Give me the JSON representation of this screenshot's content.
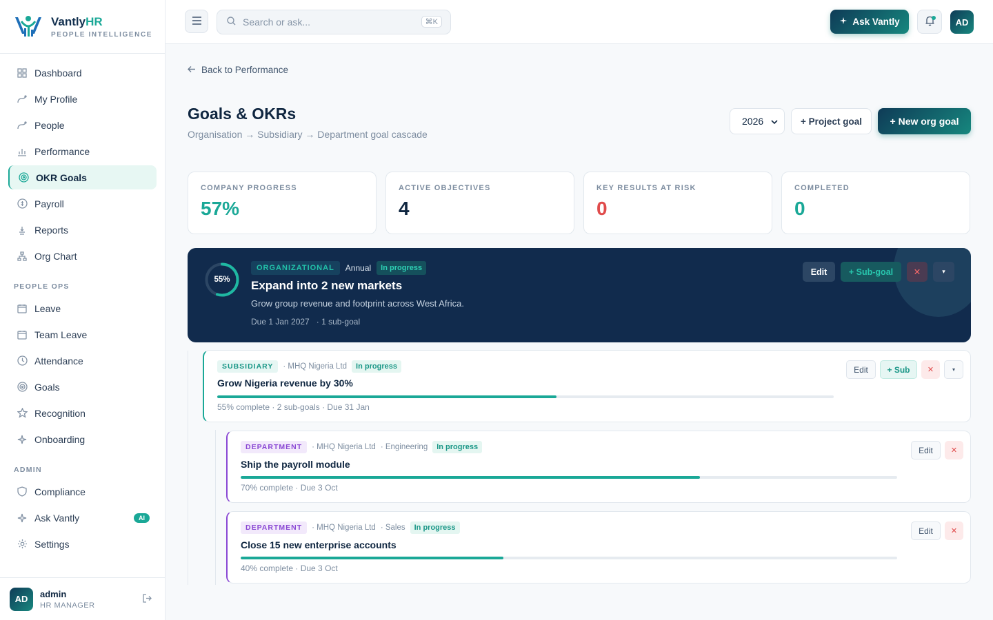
{
  "brand": {
    "name_main": "Vantly",
    "name_accent": "HR",
    "tagline": "PEOPLE INTELLIGENCE"
  },
  "sidebar": {
    "items": [
      {
        "label": "Dashboard",
        "icon": "grid-icon"
      },
      {
        "label": "My Profile",
        "icon": "profile-icon"
      },
      {
        "label": "People",
        "icon": "people-icon"
      },
      {
        "label": "Performance",
        "icon": "bar-chart-icon"
      },
      {
        "label": "OKR Goals",
        "icon": "target-icon",
        "active": true
      },
      {
        "label": "Payroll",
        "icon": "payroll-icon"
      }
    ],
    "items2": [
      {
        "label": "Reports",
        "icon": "reports-icon"
      },
      {
        "label": "Org Chart",
        "icon": "org-chart-icon"
      }
    ],
    "section_people_ops": "PEOPLE OPS",
    "people_ops": [
      {
        "label": "Leave",
        "icon": "calendar-icon"
      },
      {
        "label": "Team Leave",
        "icon": "calendar-icon"
      },
      {
        "label": "Attendance",
        "icon": "clock-icon"
      },
      {
        "label": "Goals",
        "icon": "target-icon"
      },
      {
        "label": "Recognition",
        "icon": "star-icon"
      },
      {
        "label": "Onboarding",
        "icon": "sparkle-icon"
      }
    ],
    "section_admin": "ADMIN",
    "admin": [
      {
        "label": "Compliance",
        "icon": "shield-icon"
      },
      {
        "label": "Ask Vantly",
        "icon": "sparkle-icon",
        "badge": "AI"
      },
      {
        "label": "Settings",
        "icon": "gear-icon"
      }
    ],
    "user": {
      "initials": "AD",
      "name": "admin",
      "role": "HR MANAGER"
    }
  },
  "topbar": {
    "search_placeholder": "Search or ask...",
    "shortcut": "⌘K",
    "ask_label": "Ask Vantly",
    "avatar": "AD"
  },
  "page": {
    "back_label": "Back to Performance",
    "title": "Goals & OKRs",
    "subtitle": "Organisation → Subsidiary → Department goal cascade",
    "year": "2026",
    "project_goal_label": "+ Project goal",
    "new_org_goal_label": "+ New org goal"
  },
  "stats": [
    {
      "label": "COMPANY PROGRESS",
      "value": "57%",
      "color": "#1aa897"
    },
    {
      "label": "ACTIVE OBJECTIVES",
      "value": "4",
      "color": "#0f2640"
    },
    {
      "label": "KEY RESULTS AT RISK",
      "value": "0",
      "color": "#e04b4b"
    },
    {
      "label": "COMPLETED",
      "value": "0",
      "color": "#1aa897"
    }
  ],
  "org_goal": {
    "progress_label": "55%",
    "progress": 0.55,
    "tag": "ORGANIZATIONAL",
    "period": "Annual",
    "status": "In progress",
    "title": "Expand into 2 new markets",
    "description": "Grow group revenue and footprint across West Africa.",
    "due": "Due 1 Jan 2027",
    "subgoals": "· 1 sub-goal",
    "edit_label": "Edit",
    "subgoal_label": "+ Sub-goal",
    "delete_label": "✕",
    "more_label": "▾"
  },
  "sub_goal": {
    "tag": "SUBSIDIARY",
    "entity": "· MHQ Nigeria Ltd",
    "status": "In progress",
    "title": "Grow Nigeria revenue by 30%",
    "progress": 0.55,
    "meta": "55% complete · 2 sub-goals · Due 31 Jan",
    "edit_label": "Edit",
    "sub_label": "+ Sub",
    "delete_label": "✕",
    "more_label": "▾"
  },
  "dept_goals": [
    {
      "tag": "DEPARTMENT",
      "entity": "· MHQ Nigeria Ltd",
      "dept": "· Engineering",
      "status": "In progress",
      "title": "Ship the payroll module",
      "progress": 0.7,
      "meta": "70% complete · Due 3 Oct",
      "edit_label": "Edit",
      "delete_label": "✕"
    },
    {
      "tag": "DEPARTMENT",
      "entity": "· MHQ Nigeria Ltd",
      "dept": "· Sales",
      "status": "In progress",
      "title": "Close 15 new enterprise accounts",
      "progress": 0.4,
      "meta": "40% complete · Due 3 Oct",
      "edit_label": "Edit",
      "delete_label": "✕"
    }
  ]
}
